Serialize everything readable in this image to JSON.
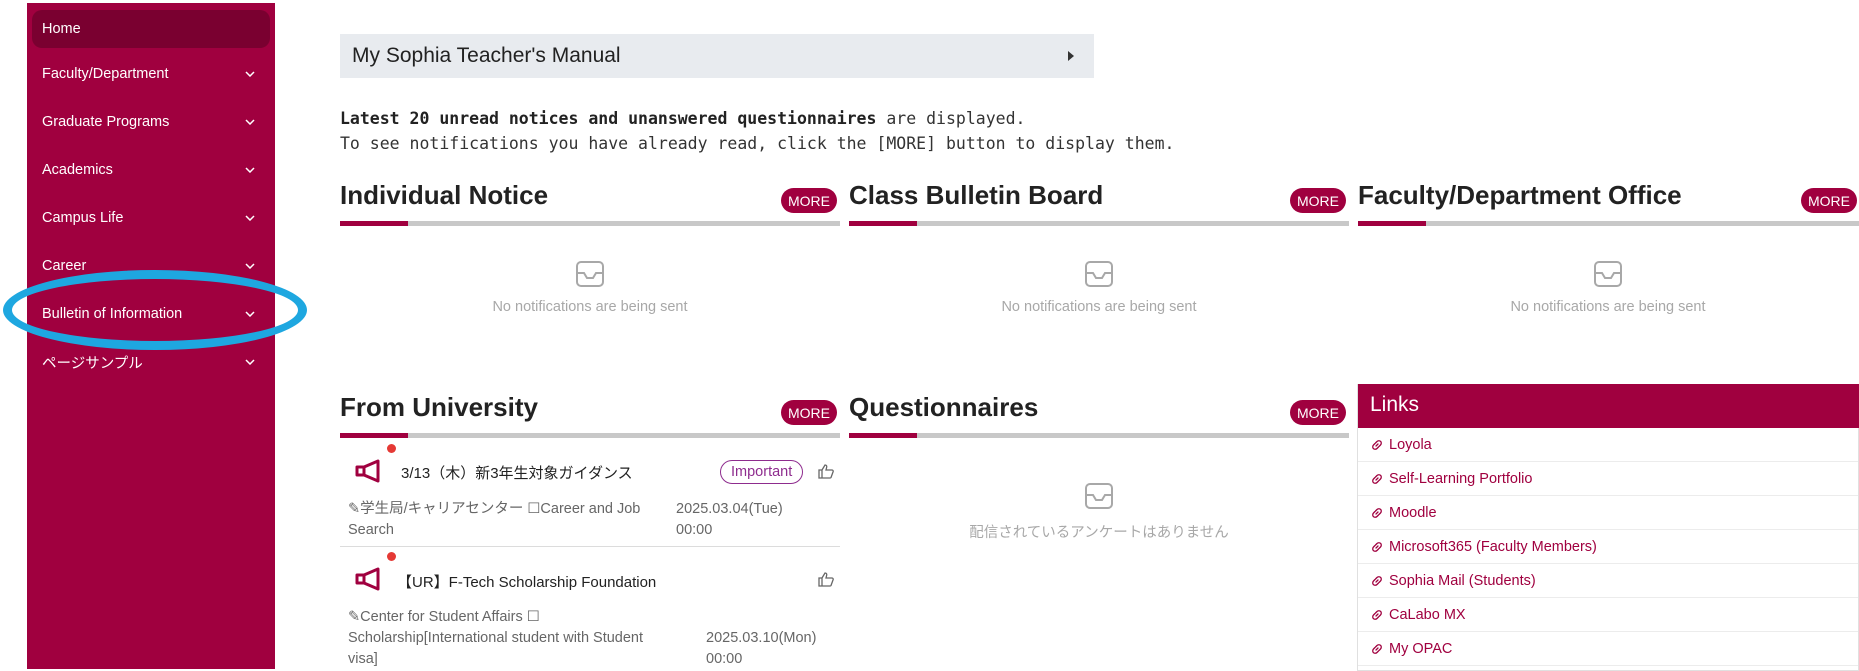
{
  "sidebar": {
    "items": [
      {
        "label": "Home",
        "active": true,
        "has_chevron": false
      },
      {
        "label": "Faculty/Department",
        "has_chevron": true
      },
      {
        "label": "Graduate Programs",
        "has_chevron": true
      },
      {
        "label": "Academics",
        "has_chevron": true
      },
      {
        "label": "Campus Life",
        "has_chevron": true
      },
      {
        "label": "Career",
        "has_chevron": true
      },
      {
        "label": "Bulletin of Information",
        "has_chevron": true,
        "highlighted": true
      },
      {
        "label": "ページサンプル",
        "has_chevron": true
      }
    ]
  },
  "manual": {
    "label": "My Sophia Teacher's Manual"
  },
  "intro": {
    "line1_bold": "Latest 20 unread notices and unanswered questionnaires",
    "line1_rest": " are displayed.",
    "line2": "To see notifications you have already read, click the [MORE] button to display them."
  },
  "more_label": "MORE",
  "sections": {
    "individual_notice": {
      "title": "Individual Notice",
      "empty": "No notifications are being sent"
    },
    "class_bulletin": {
      "title": "Class Bulletin Board",
      "empty": "No notifications are being sent"
    },
    "faculty_office": {
      "title": "Faculty/Department Office",
      "empty": "No notifications are being sent"
    },
    "from_university": {
      "title": "From University",
      "items": [
        {
          "title": "3/13（木）新3年生対象ガイダンス",
          "badge": "Important",
          "meta_line1": "学生局/キャリアセンター ☐Career and Job",
          "meta_line2": "Search",
          "date": "2025.03.04(Tue)",
          "time": "00:00"
        },
        {
          "title": "【UR】F-Tech Scholarship Foundation",
          "meta_line1": "Center for Student Affairs ☐",
          "meta_line2": "Scholarship[International student with Student",
          "meta_line3": "visa]",
          "date": "2025.03.10(Mon)",
          "time": "00:00"
        }
      ]
    },
    "questionnaires": {
      "title": "Questionnaires",
      "empty": "配信されているアンケートはありません"
    }
  },
  "links": {
    "title": "Links",
    "items": [
      "Loyola",
      "Self-Learning Portfolio",
      "Moodle",
      "Microsoft365 (Faculty Members)",
      "Sophia Mail (Students)",
      "CaLabo MX",
      "My OPAC"
    ]
  },
  "colors": {
    "brand": "#a0003f",
    "highlight": "#1ea7e0",
    "badge": "#8e2c8e"
  }
}
